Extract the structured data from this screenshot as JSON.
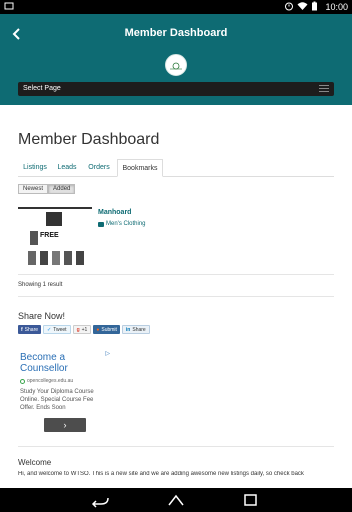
{
  "status_bar": {
    "time": "10:00"
  },
  "app_bar": {
    "title": "Member Dashboard"
  },
  "header": {
    "select_page_label": "Select Page"
  },
  "page": {
    "title": "Member Dashboard"
  },
  "tabs": [
    {
      "label": "Listings",
      "active": false
    },
    {
      "label": "Leads",
      "active": false
    },
    {
      "label": "Orders",
      "active": false
    },
    {
      "label": "Bookmarks",
      "active": true
    }
  ],
  "sort": {
    "newest_label": "Newest",
    "added_label": "Added"
  },
  "listing": {
    "title": "Manhoard",
    "category": "Men's Clothing",
    "thumb_text": "FREE"
  },
  "results": {
    "showing_text": "Showing 1 result"
  },
  "share": {
    "title": "Share Now!",
    "buttons": [
      {
        "label": "Share",
        "color": "#3b5998"
      },
      {
        "label": "Tweet",
        "color": "#55acee"
      },
      {
        "label": "+1",
        "color": "#dd4b39"
      },
      {
        "label": "Submit",
        "color": "#336699"
      },
      {
        "label": "Share",
        "color": "#0077b5"
      }
    ]
  },
  "ad": {
    "title": "Become a Counsellor",
    "url": "opencolleges.edu.au",
    "body": "Study Your Diploma Course Online. Special Course Fee Offer. Ends Soon",
    "arrow": "›"
  },
  "welcome": {
    "title": "Welcome",
    "text": "Hi, and welcome to WTSO. This is a new site and we are adding awesome new listings daily, so check back"
  },
  "colors": {
    "accent": "#0e6b73",
    "link": "#0e6b73"
  }
}
